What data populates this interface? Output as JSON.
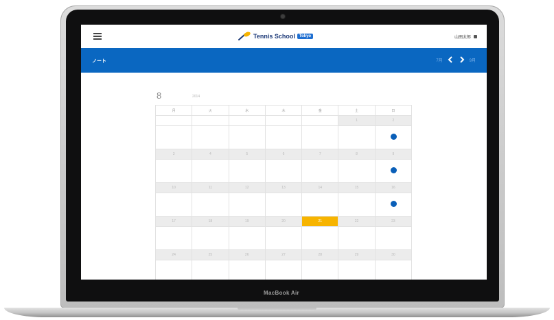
{
  "device": {
    "label": "MacBook Air"
  },
  "header": {
    "app_name": "Tennis School",
    "badge": "Tokyo",
    "user_name": "山田太郎"
  },
  "nav": {
    "title": "ノート",
    "prev_label": "7月",
    "next_label": "9月"
  },
  "calendar": {
    "month": "8",
    "year": "2014",
    "weekday_headers": [
      "月",
      "火",
      "水",
      "木",
      "金",
      "土",
      "日"
    ],
    "weeks": [
      {
        "days": [
          "",
          "",
          "",
          "",
          "",
          "1",
          "2"
        ],
        "dots": [
          false,
          false,
          false,
          false,
          false,
          false,
          true
        ],
        "today_index": -1
      },
      {
        "days": [
          "3",
          "4",
          "5",
          "6",
          "7",
          "8",
          "9"
        ],
        "dots": [
          false,
          false,
          false,
          false,
          false,
          false,
          true
        ],
        "today_index": -1
      },
      {
        "days": [
          "10",
          "11",
          "12",
          "13",
          "14",
          "15",
          "16"
        ],
        "dots": [
          false,
          false,
          false,
          false,
          false,
          false,
          true
        ],
        "today_index": -1
      },
      {
        "days": [
          "17",
          "18",
          "19",
          "20",
          "21",
          "22",
          "23"
        ],
        "dots": [
          false,
          false,
          false,
          false,
          false,
          false,
          false
        ],
        "today_index": 4
      },
      {
        "days": [
          "24",
          "25",
          "26",
          "27",
          "28",
          "29",
          "30"
        ],
        "dots": [
          false,
          false,
          false,
          false,
          false,
          false,
          false
        ],
        "today_index": -1
      }
    ]
  },
  "colors": {
    "navbar": "#0a67c1",
    "today": "#f7b400",
    "dot": "#0a5fb8"
  }
}
